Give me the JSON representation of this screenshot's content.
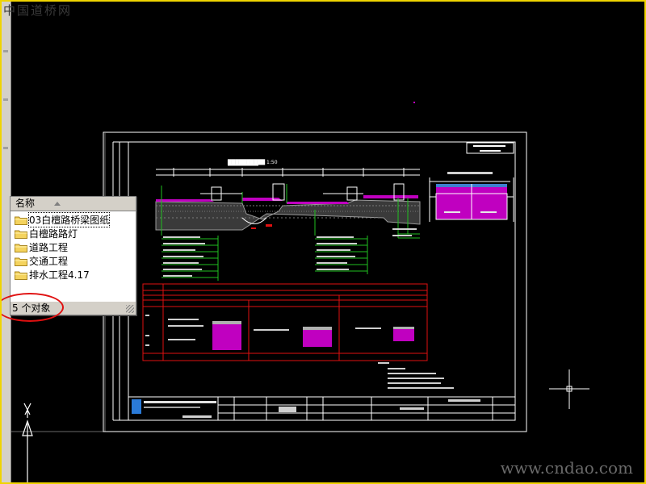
{
  "watermark_top": "中国道桥网",
  "watermark_bottom": "www.cndao.com",
  "explorer": {
    "column_header": "名称",
    "items": [
      {
        "label": "03白檀路桥梁图纸"
      },
      {
        "label": "白檀路路灯"
      },
      {
        "label": "道路工程"
      },
      {
        "label": "交通工程"
      },
      {
        "label": "排水工程4.17"
      }
    ],
    "status": "5 个对象"
  },
  "colors": {
    "frame_border": "#f0d400",
    "callout": "#e01010",
    "drawing_border": "#ffffff",
    "table_red": "#e01010",
    "leader_green": "#20c020",
    "hatch_magenta": "#c000c0"
  },
  "icons": [
    "folder-icon",
    "ucs-icon",
    "crosshair-cursor-icon",
    "sort-arrow-icon"
  ]
}
